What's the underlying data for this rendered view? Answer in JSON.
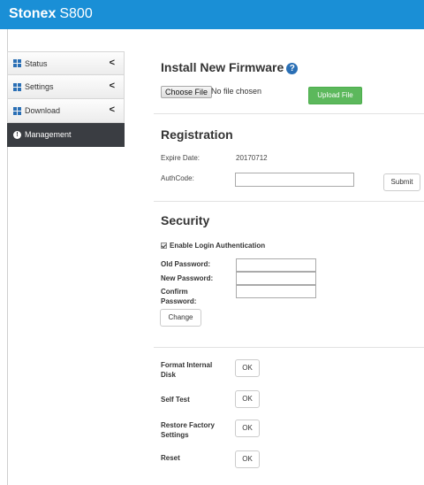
{
  "header": {
    "brand_bold": "Stonex",
    "brand_model": "S800",
    "bg_color": "#1a8fd6"
  },
  "sidebar": {
    "items": [
      {
        "label": "Status",
        "icon": "grid-icon",
        "chevron": "<"
      },
      {
        "label": "Settings",
        "icon": "grid-icon",
        "chevron": "<"
      },
      {
        "label": "Download",
        "icon": "grid-icon",
        "chevron": "<"
      },
      {
        "label": "Management",
        "icon": "info-icon",
        "active": true
      }
    ]
  },
  "firmware": {
    "title": "Install New Firmware",
    "help_icon": "?",
    "choose_label": "Choose File",
    "no_file_text": "No file chosen",
    "upload_label": "Upload File",
    "upload_color": "#5cb85c"
  },
  "registration": {
    "title": "Registration",
    "expire_label": "Expire Date:",
    "expire_value": "20170712",
    "authcode_label": "AuthCode:",
    "authcode_value": "",
    "submit_label": "Submit"
  },
  "security": {
    "title": "Security",
    "enable_label": "Enable Login Authentication",
    "enable_checked": true,
    "old_password_label": "Old Password:",
    "new_password_label": "New Password:",
    "confirm_password_label_1": "Confirm",
    "confirm_password_label_2": "Password:",
    "change_label": "Change"
  },
  "actions": {
    "format_label_1": "Format Internal",
    "format_label_2": "Disk",
    "format_ok": "OK",
    "selftest_label": "Self Test",
    "selftest_ok": "OK",
    "restore_label_1": "Restore Factory",
    "restore_label_2": "Settings",
    "restore_ok": "OK",
    "reset_label": "Reset",
    "reset_ok": "OK"
  }
}
